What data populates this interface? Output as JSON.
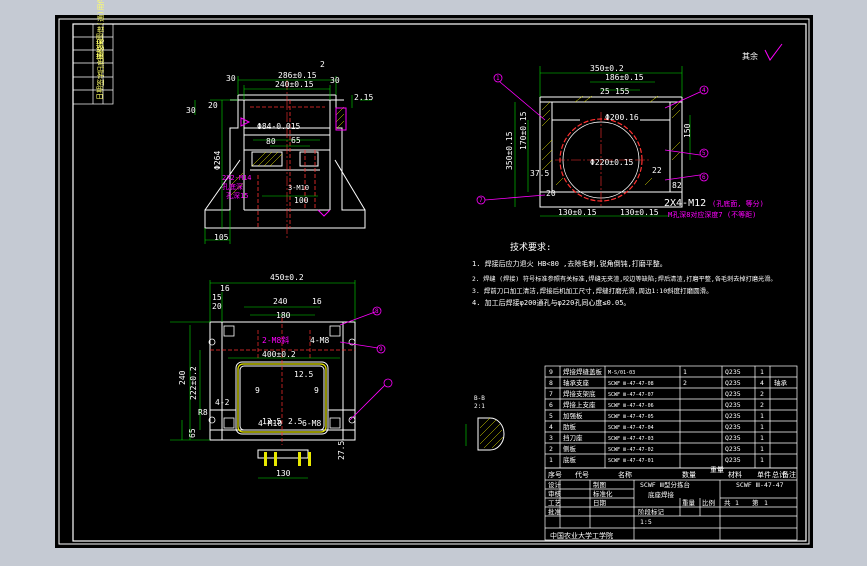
{
  "colors": {
    "outer_bg": "#c5cad3",
    "canvas": "#000000",
    "frame": "#ffffff",
    "part": "#ffffff",
    "dim": "#00e000",
    "hidden": "#ff3030",
    "center": "#ff3030",
    "hatch": "#e8e800",
    "leader": "#ff00ff",
    "text": "#ffffff",
    "note_pen": "#ffff66",
    "symbol": "#ff00ff"
  },
  "left_view": {
    "dims": {
      "top_outer": "286±0.15",
      "top_inner": "240±0.15",
      "left_30": "30",
      "right_30": "30",
      "right_2": "2",
      "right_215": "2.15",
      "left_30b": "30",
      "left_20": "20",
      "bore": "Φ84-0.015",
      "dim_80": "80",
      "dim_65": "65",
      "dim_100": "100",
      "height": "Φ264",
      "bottom_105": "105"
    },
    "labels": {
      "thread_a": "2X2-M14",
      "thread_a_sub": "孔底深",
      "thread_b": "3-M10",
      "thread_c": "孔深15"
    }
  },
  "right_view": {
    "dims": {
      "top_outer": "350±0.2",
      "top_mid": "186±0.15",
      "top_155": "155",
      "top_25": "25",
      "bore_top": "Φ200.16",
      "bore_low": "Φ220±0.15",
      "right_150": "150",
      "left_height": "350±0.15",
      "left_170": "170±0.15",
      "left_375": "37.5",
      "dim_20": "20",
      "dim_22": "22",
      "dim_82": "82",
      "bottom_left": "130±0.15",
      "bottom_right": "130±0.15"
    },
    "balloons": {
      "a": "1",
      "b": "4",
      "c": "5",
      "d": "6",
      "e": "7"
    },
    "labels": {
      "thread": "2X4-M12",
      "thread_note": "(孔底面, 等分)",
      "thread_note2": "M孔深8对应深度7 (不等距)"
    }
  },
  "plan_view": {
    "dims": {
      "top_outer": "450±0.2",
      "top_16a": "16",
      "top_15": "15",
      "top_20": "20",
      "top_240": "240",
      "top_16b": "16",
      "top_180": "180",
      "mid_400": "400±0.2",
      "left_240": "240",
      "left_222": "222±0.2",
      "left_65": "65",
      "left_42": "4-2",
      "left_r8": "R8",
      "right_125": "12.5",
      "right_9": "9",
      "right_25": "2.5",
      "bottom_275": "27.5",
      "bottom_130": "130",
      "bottom_125": "12.5"
    },
    "labels": {
      "holes_a": "2-M8斜",
      "holes_b": "4-M8",
      "holes_c": "4-M10",
      "holes_d": "6-M8"
    },
    "balloons": {
      "a": "8",
      "b": "9"
    }
  },
  "detail": {
    "label": "B-B",
    "scale": "2:1"
  },
  "roughness": {
    "label": "其余"
  },
  "notes": {
    "title": "技术要求:",
    "items": [
      "1. 焊接后应力退火 HB<80 ,去除毛刺,锐角倒钝,打磨平整。",
      "2. 焊缝   (焊接) 符号标准参照有关标准,焊缝无夹渣,咬边等缺陷;焊后清渣,打磨平整,各毛刺去掉打磨光滑。",
      "3. 焊前刀口加工清洁,焊接后机加工尺寸,焊缝打磨光滑,周边1:10斜度打磨圆滑。",
      "4. 加工后焊接φ200通孔与φ220孔同心度≤0.05。"
    ]
  },
  "bom": {
    "rows": [
      {
        "no": "9",
        "name": "焊接焊缝盖板",
        "code": "M-S/01-03",
        "qty": "1",
        "mat": "Q235",
        "n": "1",
        "note": ""
      },
      {
        "no": "8",
        "name": "轴承支座",
        "code": "SCWF Ⅲ-47-47-08",
        "qty": "2",
        "mat": "Q235",
        "n": "4",
        "note": "轴承"
      },
      {
        "no": "7",
        "name": "焊接支架底",
        "code": "SCWF Ⅲ-47-47-07",
        "qty": "",
        "mat": "Q235",
        "n": "2",
        "note": ""
      },
      {
        "no": "6",
        "name": "焊接上支座",
        "code": "SCWF Ⅲ-47-47-06",
        "qty": "",
        "mat": "Q235",
        "n": "2",
        "note": ""
      },
      {
        "no": "5",
        "name": "加强板",
        "code": "SCWF Ⅲ-47-47-05",
        "qty": "",
        "mat": "Q235",
        "n": "1",
        "note": ""
      },
      {
        "no": "4",
        "name": "肋板",
        "code": "SCWF Ⅲ-47-47-04",
        "qty": "",
        "mat": "Q235",
        "n": "1",
        "note": ""
      },
      {
        "no": "3",
        "name": "挡刀座",
        "code": "SCWF Ⅲ-47-47-03",
        "qty": "",
        "mat": "Q235",
        "n": "1",
        "note": ""
      },
      {
        "no": "2",
        "name": "侧板",
        "code": "SCWF Ⅲ-47-47-02",
        "qty": "",
        "mat": "Q235",
        "n": "1",
        "note": ""
      },
      {
        "no": "1",
        "name": "底板",
        "code": "SCWF Ⅲ-47-47-01",
        "qty": "",
        "mat": "Q235",
        "n": "1",
        "note": ""
      }
    ],
    "header": {
      "no": "序号",
      "code": "代号",
      "name": "名称",
      "qty": "数量",
      "mat": "材料",
      "single": "单件",
      "total": "总计",
      "note": "备注"
    },
    "weight": "重量"
  },
  "title_block": {
    "designer": "设计",
    "checker": "审核",
    "approver": "批准",
    "process": "工艺",
    "drafter": "制图",
    "standard": "标准化",
    "date": "日期",
    "product": "SCWF Ⅲ型分拣台",
    "drawing_name": "底座焊接",
    "drawing_code": "SCWF Ⅲ-47-47",
    "stage": "阶段标记",
    "weight": "重量",
    "scale_label": "比例",
    "scale": "1:5",
    "sheet": "共",
    "of": "第",
    "company": "中国农业大学工学院",
    "sheet_num": "1",
    "total_num": "1"
  },
  "side_strip": {
    "labels": [
      "借(通)用件登记",
      "描图",
      "描校",
      "旧底图总号",
      "签字",
      "日期"
    ]
  }
}
